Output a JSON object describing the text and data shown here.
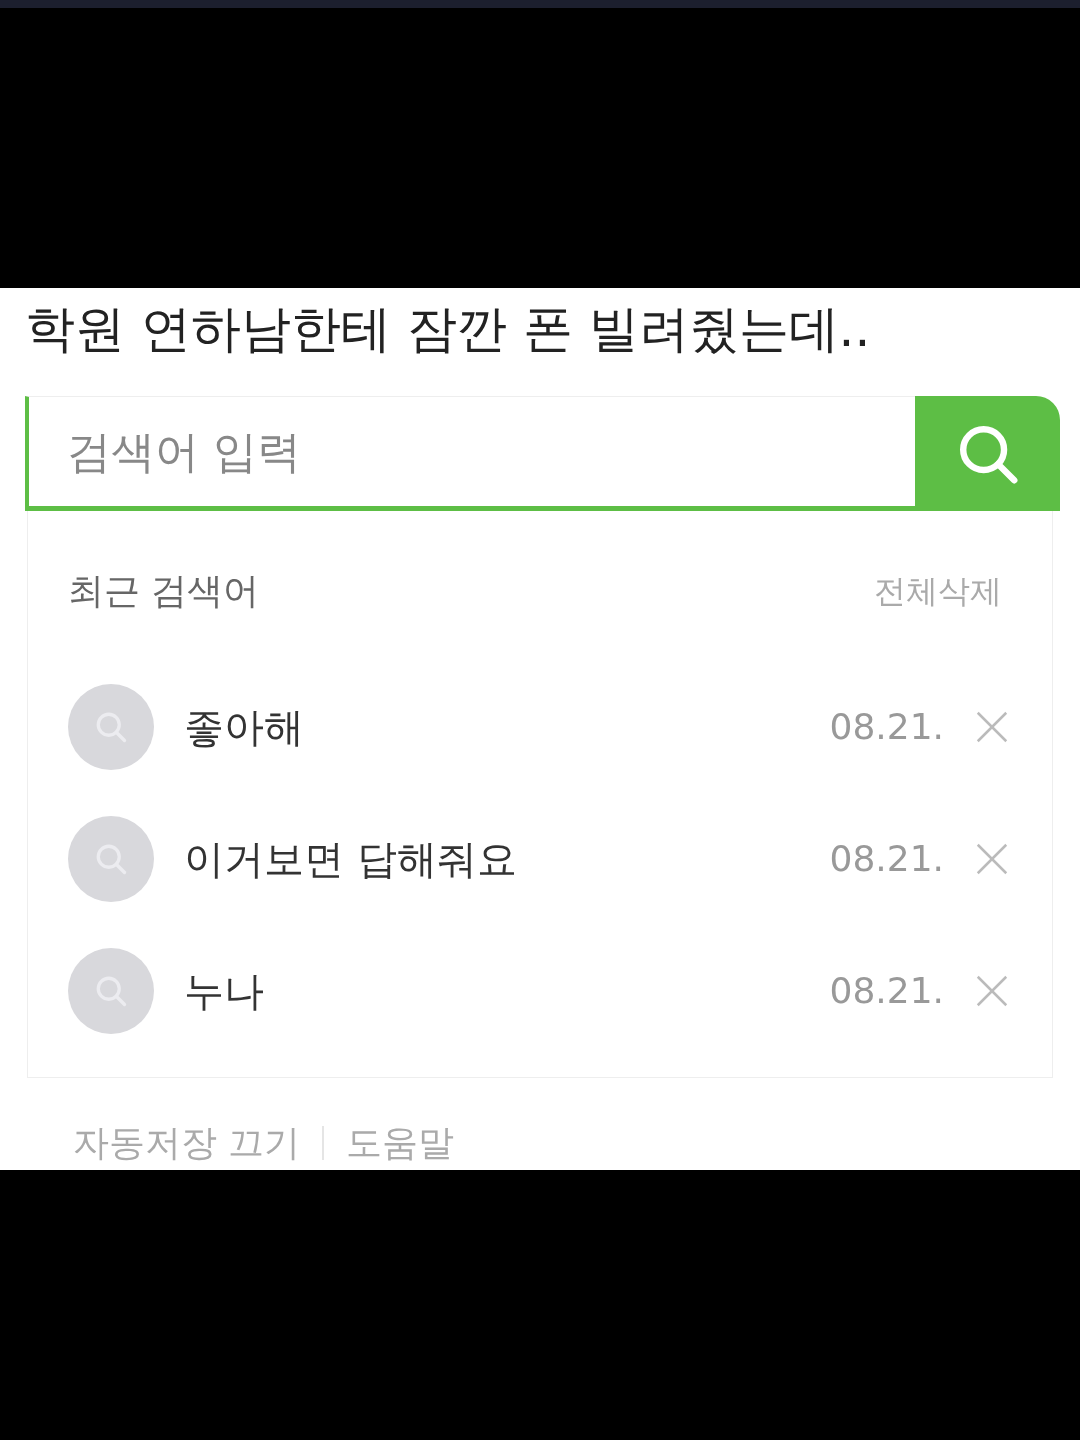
{
  "caption": "학원 연하남한테 잠깐 폰 빌려줬는데..",
  "search": {
    "placeholder": "검색어 입력"
  },
  "recent": {
    "title": "최근 검색어",
    "clear_all": "전체삭제",
    "items": [
      {
        "query": "좋아해",
        "date": "08.21."
      },
      {
        "query": "이거보면 답해줘요",
        "date": "08.21."
      },
      {
        "query": "누나",
        "date": "08.21."
      }
    ]
  },
  "footer": {
    "links": [
      "자동저장 끄기",
      "도움말"
    ]
  }
}
